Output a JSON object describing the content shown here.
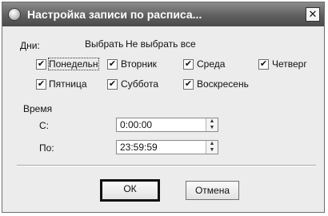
{
  "window": {
    "title": "Настройка записи по расписа...",
    "close_glyph": "✕"
  },
  "days": {
    "label": "Дни:",
    "select_all": "Выбрать все",
    "deselect_all": "Не выбрать все",
    "items": [
      {
        "label": "Понедельн",
        "checked": true
      },
      {
        "label": "Вторник",
        "checked": true
      },
      {
        "label": "Среда",
        "checked": true
      },
      {
        "label": "Четверг",
        "checked": true
      },
      {
        "label": "Пятница",
        "checked": true
      },
      {
        "label": "Суббота",
        "checked": true
      },
      {
        "label": "Воскресень",
        "checked": true
      }
    ],
    "check_glyph": "✔"
  },
  "time": {
    "label": "Время",
    "from_label": "С:",
    "from_value": "0:00:00",
    "to_label": "По:",
    "to_value": "23:59:59",
    "spin_up": "▲",
    "spin_down": "▼"
  },
  "buttons": {
    "ok": "ОК",
    "cancel": "Отмена"
  }
}
